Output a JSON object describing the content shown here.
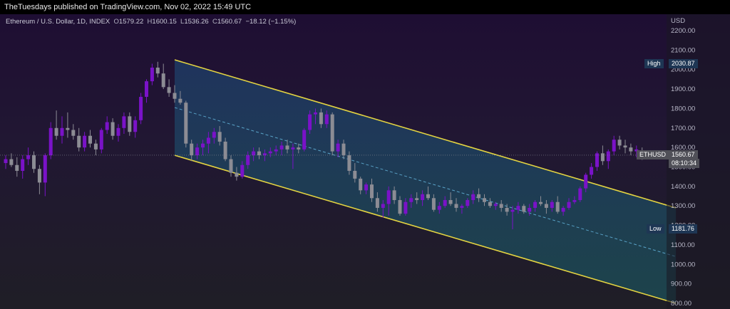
{
  "header": {
    "published_by": "TheTuesdays published on TradingView.com, Nov 02, 2022 15:49 UTC"
  },
  "legend": {
    "symbol": "Ethereum / U.S. Dollar, 1D, INDEX",
    "open_label": "O",
    "open": "1579.22",
    "high_label": "H",
    "high": "1600.15",
    "low_label": "L",
    "low": "1536.26",
    "close_label": "C",
    "close": "1560.67",
    "change": "−18.12 (−1.15%)"
  },
  "price_axis": {
    "currency": "USD",
    "ticks": [
      "2200.00",
      "2100.00",
      "2000.00",
      "1900.00",
      "1800.00",
      "1700.00",
      "1600.00",
      "1500.00",
      "1400.00",
      "1300.00",
      "1200.00",
      "1100.00",
      "1000.00",
      "900.00",
      "800.00"
    ]
  },
  "tags": {
    "high": {
      "label": "High",
      "value": "2030.87"
    },
    "low": {
      "label": "Low",
      "value": "1181.76"
    },
    "current": {
      "label": "ETHUSD",
      "value": "1560.67",
      "countdown": "08:10:34"
    }
  },
  "colors": {
    "up": "#7a12c8",
    "down": "#8c8c94",
    "channel_line": "#e3d341",
    "midline": "#5aa3c8",
    "tag_bg": "#1e3654"
  },
  "chart_data": {
    "type": "candlestick",
    "title": "Ethereum / U.S. Dollar, 1D, INDEX",
    "ylim": [
      800,
      2200
    ],
    "y_scale": "linear",
    "grid": false,
    "annotations": [
      "descending parallel channel",
      "channel midline (dashed)"
    ],
    "candles": [
      [
        1520,
        1560,
        1490,
        1540
      ],
      [
        1540,
        1570,
        1500,
        1510
      ],
      [
        1510,
        1550,
        1450,
        1480
      ],
      [
        1480,
        1560,
        1440,
        1540
      ],
      [
        1540,
        1600,
        1510,
        1560
      ],
      [
        1560,
        1580,
        1470,
        1490
      ],
      [
        1490,
        1510,
        1360,
        1420
      ],
      [
        1420,
        1570,
        1350,
        1560
      ],
      [
        1560,
        1730,
        1540,
        1700
      ],
      [
        1700,
        1790,
        1640,
        1660
      ],
      [
        1660,
        1760,
        1620,
        1700
      ],
      [
        1700,
        1780,
        1650,
        1690
      ],
      [
        1690,
        1720,
        1640,
        1660
      ],
      [
        1660,
        1700,
        1580,
        1600
      ],
      [
        1600,
        1680,
        1580,
        1660
      ],
      [
        1660,
        1690,
        1600,
        1620
      ],
      [
        1620,
        1640,
        1560,
        1590
      ],
      [
        1590,
        1700,
        1570,
        1690
      ],
      [
        1690,
        1760,
        1670,
        1730
      ],
      [
        1730,
        1750,
        1640,
        1660
      ],
      [
        1660,
        1720,
        1630,
        1700
      ],
      [
        1700,
        1780,
        1670,
        1760
      ],
      [
        1760,
        1780,
        1660,
        1680
      ],
      [
        1680,
        1760,
        1650,
        1740
      ],
      [
        1740,
        1880,
        1720,
        1860
      ],
      [
        1860,
        1950,
        1830,
        1940
      ],
      [
        1940,
        2030,
        1920,
        2010
      ],
      [
        2010,
        2040,
        1960,
        1980
      ],
      [
        1980,
        2030,
        1900,
        1910
      ],
      [
        1910,
        1950,
        1860,
        1880
      ],
      [
        1880,
        1920,
        1830,
        1850
      ],
      [
        1850,
        1890,
        1820,
        1830
      ],
      [
        1830,
        1840,
        1600,
        1620
      ],
      [
        1620,
        1640,
        1530,
        1560
      ],
      [
        1560,
        1620,
        1540,
        1600
      ],
      [
        1600,
        1640,
        1560,
        1620
      ],
      [
        1620,
        1680,
        1570,
        1650
      ],
      [
        1650,
        1700,
        1620,
        1680
      ],
      [
        1680,
        1710,
        1610,
        1630
      ],
      [
        1630,
        1650,
        1530,
        1540
      ],
      [
        1540,
        1560,
        1450,
        1470
      ],
      [
        1470,
        1500,
        1430,
        1450
      ],
      [
        1450,
        1530,
        1440,
        1510
      ],
      [
        1510,
        1580,
        1490,
        1560
      ],
      [
        1560,
        1600,
        1530,
        1580
      ],
      [
        1580,
        1600,
        1540,
        1560
      ],
      [
        1560,
        1590,
        1530,
        1570
      ],
      [
        1570,
        1600,
        1550,
        1580
      ],
      [
        1580,
        1610,
        1560,
        1590
      ],
      [
        1590,
        1630,
        1560,
        1610
      ],
      [
        1610,
        1640,
        1570,
        1590
      ],
      [
        1590,
        1620,
        1490,
        1600
      ],
      [
        1600,
        1620,
        1570,
        1590
      ],
      [
        1590,
        1700,
        1580,
        1690
      ],
      [
        1690,
        1790,
        1670,
        1770
      ],
      [
        1770,
        1800,
        1720,
        1780
      ],
      [
        1780,
        1800,
        1700,
        1720
      ],
      [
        1720,
        1790,
        1700,
        1770
      ],
      [
        1770,
        1780,
        1560,
        1580
      ],
      [
        1580,
        1640,
        1550,
        1620
      ],
      [
        1620,
        1640,
        1540,
        1560
      ],
      [
        1560,
        1580,
        1460,
        1480
      ],
      [
        1480,
        1520,
        1420,
        1440
      ],
      [
        1440,
        1450,
        1360,
        1380
      ],
      [
        1380,
        1420,
        1360,
        1410
      ],
      [
        1410,
        1440,
        1320,
        1340
      ],
      [
        1340,
        1370,
        1270,
        1290
      ],
      [
        1290,
        1330,
        1240,
        1310
      ],
      [
        1310,
        1400,
        1250,
        1380
      ],
      [
        1380,
        1400,
        1310,
        1330
      ],
      [
        1330,
        1350,
        1250,
        1260
      ],
      [
        1260,
        1340,
        1250,
        1320
      ],
      [
        1320,
        1360,
        1290,
        1340
      ],
      [
        1340,
        1370,
        1310,
        1330
      ],
      [
        1330,
        1380,
        1300,
        1360
      ],
      [
        1360,
        1400,
        1330,
        1340
      ],
      [
        1340,
        1360,
        1270,
        1280
      ],
      [
        1280,
        1320,
        1260,
        1300
      ],
      [
        1300,
        1350,
        1290,
        1330
      ],
      [
        1330,
        1370,
        1300,
        1310
      ],
      [
        1310,
        1340,
        1270,
        1290
      ],
      [
        1290,
        1310,
        1260,
        1300
      ],
      [
        1300,
        1340,
        1290,
        1330
      ],
      [
        1330,
        1380,
        1310,
        1360
      ],
      [
        1360,
        1390,
        1320,
        1340
      ],
      [
        1340,
        1360,
        1300,
        1320
      ],
      [
        1320,
        1340,
        1290,
        1300
      ],
      [
        1300,
        1320,
        1280,
        1310
      ],
      [
        1310,
        1330,
        1270,
        1290
      ],
      [
        1290,
        1310,
        1250,
        1270
      ],
      [
        1270,
        1300,
        1180,
        1280
      ],
      [
        1280,
        1320,
        1260,
        1300
      ],
      [
        1300,
        1310,
        1260,
        1270
      ],
      [
        1270,
        1310,
        1250,
        1290
      ],
      [
        1290,
        1330,
        1270,
        1320
      ],
      [
        1320,
        1350,
        1300,
        1310
      ],
      [
        1310,
        1330,
        1260,
        1290
      ],
      [
        1290,
        1330,
        1270,
        1320
      ],
      [
        1320,
        1350,
        1260,
        1270
      ],
      [
        1270,
        1300,
        1250,
        1290
      ],
      [
        1290,
        1340,
        1280,
        1320
      ],
      [
        1320,
        1350,
        1310,
        1330
      ],
      [
        1330,
        1400,
        1320,
        1390
      ],
      [
        1390,
        1470,
        1370,
        1460
      ],
      [
        1460,
        1520,
        1440,
        1500
      ],
      [
        1500,
        1580,
        1480,
        1570
      ],
      [
        1570,
        1610,
        1510,
        1530
      ],
      [
        1530,
        1590,
        1490,
        1580
      ],
      [
        1580,
        1660,
        1560,
        1640
      ],
      [
        1640,
        1660,
        1590,
        1610
      ],
      [
        1610,
        1640,
        1570,
        1600
      ],
      [
        1600,
        1620,
        1560,
        1580
      ],
      [
        1580,
        1610,
        1550,
        1590
      ],
      [
        1579.22,
        1600.15,
        1536.26,
        1560.67
      ]
    ],
    "channel": {
      "upper": [
        [
          30,
          2050
        ],
        [
          119,
          1290
        ]
      ],
      "lower": [
        [
          30,
          1560
        ],
        [
          119,
          800
        ]
      ],
      "midline": [
        [
          30,
          1805
        ],
        [
          119,
          1040
        ]
      ]
    }
  }
}
